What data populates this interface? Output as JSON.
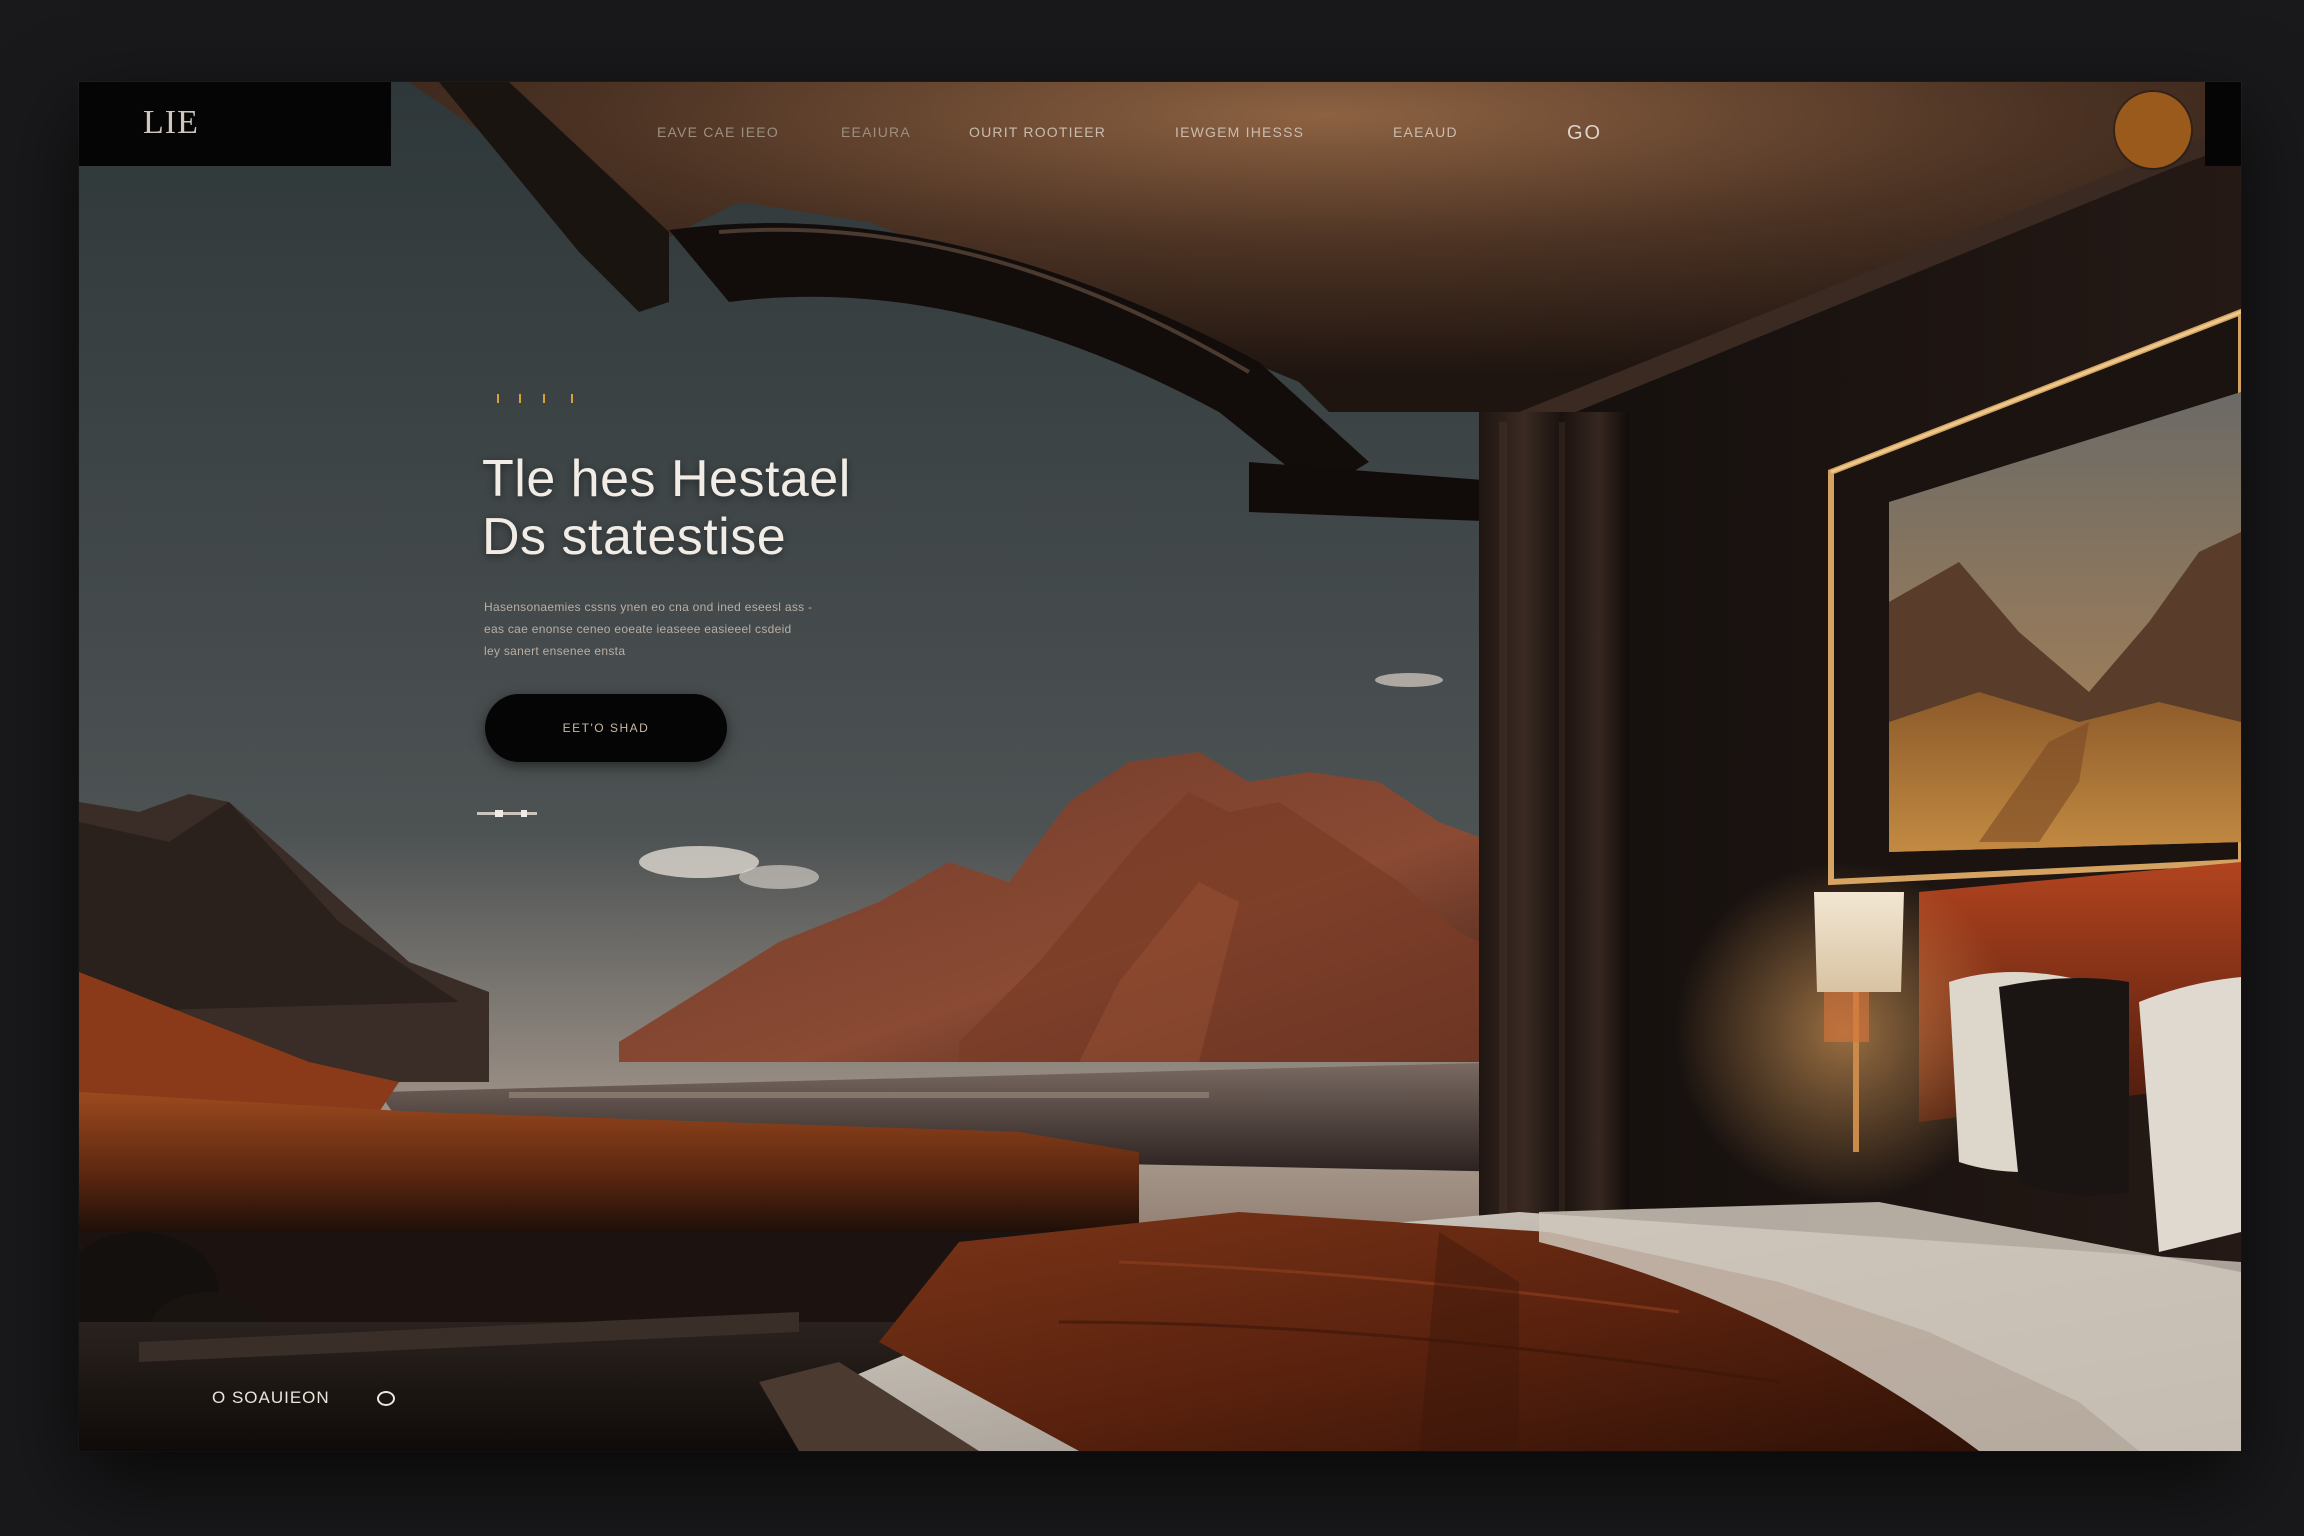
{
  "brand": {
    "logo_text": "LIE"
  },
  "nav": {
    "items": [
      {
        "label": "EAVE CAE IEEO"
      },
      {
        "label": "EEAIURA"
      },
      {
        "label": "OURIT ROOTIEER"
      },
      {
        "label": "IEWGEM IHESSS"
      },
      {
        "label": "EAEAUD"
      }
    ],
    "go_label": "GO"
  },
  "hero": {
    "title_line1": "Tle hes Hestael",
    "title_line2": "Ds statestise",
    "body_lines": [
      "Hasensonaemies cssns ynen eo cna ond ined eseesl ass -",
      "eas cae enonse ceneo eoeate ieaseee easieeel csdeid",
      "ley sanert ensenee ensta"
    ],
    "cta_label": "EET'O SHAD"
  },
  "footer": {
    "label": "O SOAUIEON"
  },
  "colors": {
    "accent_gold": "#d6a13a",
    "avatar_orange": "#9a5a1c",
    "frame_dark": "#050505",
    "page_bg": "#19191b"
  }
}
